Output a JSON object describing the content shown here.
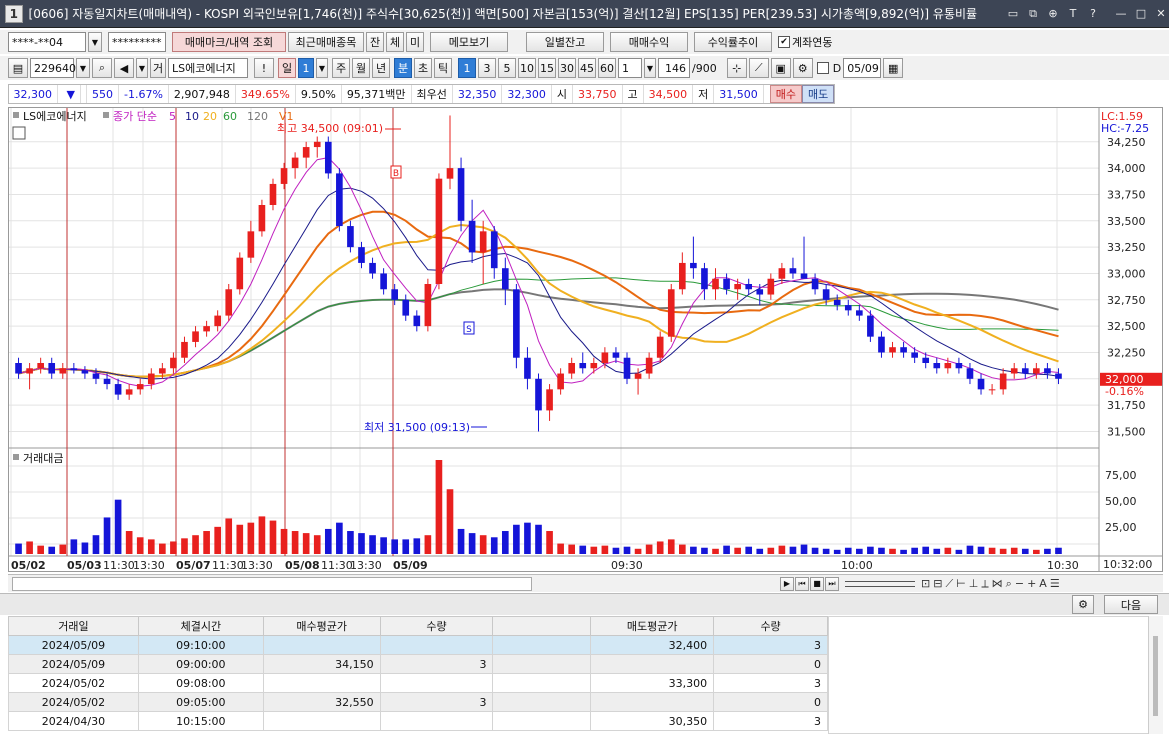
{
  "title": {
    "number": "1",
    "text": "[0606] 자동일지차트(매매내역) - KOSPI 외국인보유[1,746(천)] 주식수[30,625(천)] 액면[500] 자본금[153(억)] 결산[12월] EPS[135] PER[239.53] 시가총액[9,892(억)] 유통비률"
  },
  "toolbar1": {
    "account": "****-**04",
    "password": "*********",
    "mark_button": "매매마크/내역 조회",
    "recent_button": "최근매매종목",
    "b_jan": "잔",
    "b_che": "체",
    "b_mi": "미",
    "memo_button": "메모보기",
    "daily_balance": "일별잔고",
    "trade_profit": "매매수익",
    "return_trend": "수익률추이",
    "link_label": "계좌연동"
  },
  "toolbar2": {
    "code": "229640",
    "geo": "거",
    "name": "LS에코에너지",
    "excl": "!",
    "period_il": "일",
    "period_value": "1",
    "ju": "주",
    "wol": "월",
    "nyeon": "년",
    "bun": "분",
    "cho": "초",
    "tik": "틱",
    "intervals": [
      "1",
      "3",
      "5",
      "10",
      "15",
      "30",
      "45",
      "60"
    ],
    "count": "1",
    "bars": "146",
    "bars_total": "/900",
    "d_label": "D",
    "date": "05/09"
  },
  "quote": {
    "price": "32,300",
    "arrow": "▼",
    "change": "550",
    "change_pct": "-1.67%",
    "volume": "2,907,948",
    "vol_ratio": "349.65%",
    "turnover": "9.50%",
    "amount": "95,371백만",
    "priority_label": "최우선",
    "ask": "32,350",
    "bid": "32,300",
    "open_label": "시",
    "open": "33,750",
    "high_label": "고",
    "high": "34,500",
    "low_label": "저",
    "low": "31,500",
    "buy": "매수",
    "sell": "매도"
  },
  "chart": {
    "legend_name": "LS에코에너지",
    "legend_ma_label": "종가 단순",
    "ma_periods": [
      "5",
      "10",
      "20",
      "60",
      "120"
    ],
    "legend_v": "V1",
    "lc": "LC:1.59",
    "hc": "HC:-7.25",
    "high_note": "최고 34,500 (09:01)",
    "low_note": "최저 31,500 (09:13)",
    "b_marker": "B",
    "s_marker": "S",
    "y_ticks": [
      "34,250",
      "34,000",
      "33,750",
      "33,500",
      "33,250",
      "33,000",
      "32,750",
      "32,500",
      "32,250",
      "32,000",
      "31,750",
      "31,500"
    ],
    "current_price": "32,000",
    "current_pct": "-0.16%",
    "vol_label": "거래대금",
    "vol_ticks": [
      "75,00",
      "50,00",
      "25,00"
    ],
    "x_labels": [
      "05/02",
      "05/03",
      "11:30",
      "13:30",
      "05/07",
      "11:30",
      "13:30",
      "05/08",
      "11:30",
      "13:30",
      "05/09",
      "09:30",
      "10:00",
      "10:30"
    ],
    "time_right": "10:32:00",
    "colors": {
      "up": "#e8201e",
      "down": "#1515d8",
      "ma5": "#c020c0",
      "ma10": "#1a1a8a",
      "ma20": "#f0b020",
      "ma60": "#2a9a3a",
      "ma120": "#777777",
      "orange": "#e86a10"
    }
  },
  "chart_data": {
    "type": "candlestick",
    "ylim": [
      31400,
      34400
    ],
    "candles": [
      [
        32150,
        32200,
        32000,
        32050
      ],
      [
        32050,
        32150,
        31900,
        32100
      ],
      [
        32100,
        32200,
        32050,
        32150
      ],
      [
        32150,
        32200,
        32000,
        32050
      ],
      [
        32050,
        32150,
        32000,
        32100
      ],
      [
        32100,
        32150,
        32050,
        32080
      ],
      [
        32080,
        32120,
        32000,
        32050
      ],
      [
        32050,
        32100,
        31950,
        32000
      ],
      [
        32000,
        32050,
        31900,
        31950
      ],
      [
        31950,
        32000,
        31800,
        31850
      ],
      [
        31850,
        31950,
        31800,
        31900
      ],
      [
        31900,
        32000,
        31850,
        31950
      ],
      [
        31950,
        32100,
        31900,
        32050
      ],
      [
        32050,
        32150,
        32000,
        32100
      ],
      [
        32100,
        32250,
        32050,
        32200
      ],
      [
        32200,
        32400,
        32150,
        32350
      ],
      [
        32350,
        32500,
        32300,
        32450
      ],
      [
        32450,
        32550,
        32400,
        32500
      ],
      [
        32500,
        32650,
        32450,
        32600
      ],
      [
        32600,
        32900,
        32550,
        32850
      ],
      [
        32850,
        33200,
        32800,
        33150
      ],
      [
        33150,
        33500,
        33100,
        33400
      ],
      [
        33400,
        33700,
        33350,
        33650
      ],
      [
        33650,
        33900,
        33600,
        33850
      ],
      [
        33850,
        34050,
        33800,
        34000
      ],
      [
        34000,
        34150,
        33900,
        34100
      ],
      [
        34100,
        34250,
        34000,
        34200
      ],
      [
        34200,
        34300,
        34100,
        34250
      ],
      [
        34250,
        34300,
        33900,
        33950
      ],
      [
        33950,
        34000,
        33400,
        33450
      ],
      [
        33450,
        33500,
        33200,
        33250
      ],
      [
        33250,
        33300,
        33050,
        33100
      ],
      [
        33100,
        33150,
        32950,
        33000
      ],
      [
        33000,
        33050,
        32800,
        32850
      ],
      [
        32850,
        32900,
        32700,
        32750
      ],
      [
        32750,
        32800,
        32550,
        32600
      ],
      [
        32600,
        32650,
        32450,
        32500
      ],
      [
        32500,
        32950,
        32450,
        32900
      ],
      [
        32900,
        33950,
        32850,
        33900
      ],
      [
        33900,
        34500,
        33800,
        34000
      ],
      [
        34000,
        34100,
        33400,
        33500
      ],
      [
        33500,
        33700,
        33100,
        33200
      ],
      [
        33200,
        33500,
        32900,
        33400
      ],
      [
        33400,
        33450,
        32950,
        33050
      ],
      [
        33050,
        33150,
        32700,
        32850
      ],
      [
        32850,
        32900,
        32100,
        32200
      ],
      [
        32200,
        32300,
        31900,
        32000
      ],
      [
        32000,
        32050,
        31500,
        31700
      ],
      [
        31700,
        31950,
        31600,
        31900
      ],
      [
        31900,
        32100,
        31850,
        32050
      ],
      [
        32050,
        32200,
        32000,
        32150
      ],
      [
        32150,
        32250,
        32050,
        32100
      ],
      [
        32100,
        32200,
        32050,
        32150
      ],
      [
        32150,
        32300,
        32100,
        32250
      ],
      [
        32250,
        32300,
        32150,
        32200
      ],
      [
        32200,
        32250,
        31950,
        32000
      ],
      [
        32000,
        32100,
        31850,
        32050
      ],
      [
        32050,
        32250,
        32000,
        32200
      ],
      [
        32200,
        32450,
        32150,
        32400
      ],
      [
        32400,
        32900,
        32350,
        32850
      ],
      [
        32850,
        33200,
        32800,
        33100
      ],
      [
        33100,
        33350,
        32950,
        33050
      ],
      [
        33050,
        33100,
        32750,
        32850
      ],
      [
        32850,
        33050,
        32750,
        32950
      ],
      [
        32950,
        33000,
        32800,
        32850
      ],
      [
        32850,
        32950,
        32750,
        32900
      ],
      [
        32900,
        32950,
        32800,
        32850
      ],
      [
        32850,
        32900,
        32700,
        32800
      ],
      [
        32800,
        33000,
        32750,
        32950
      ],
      [
        32950,
        33100,
        32900,
        33050
      ],
      [
        33050,
        33150,
        32950,
        33000
      ],
      [
        33000,
        33350,
        32950,
        32950
      ],
      [
        32950,
        33000,
        32800,
        32850
      ],
      [
        32850,
        32900,
        32700,
        32750
      ],
      [
        32750,
        32800,
        32650,
        32700
      ],
      [
        32700,
        32750,
        32600,
        32650
      ],
      [
        32650,
        32700,
        32550,
        32600
      ],
      [
        32600,
        32650,
        32350,
        32400
      ],
      [
        32400,
        32450,
        32200,
        32250
      ],
      [
        32250,
        32350,
        32200,
        32300
      ],
      [
        32300,
        32350,
        32200,
        32250
      ],
      [
        32250,
        32300,
        32150,
        32200
      ],
      [
        32200,
        32250,
        32100,
        32150
      ],
      [
        32150,
        32200,
        32050,
        32100
      ],
      [
        32100,
        32200,
        32050,
        32150
      ],
      [
        32150,
        32200,
        32050,
        32100
      ],
      [
        32100,
        32150,
        31950,
        32000
      ],
      [
        32000,
        32050,
        31850,
        31900
      ],
      [
        31900,
        31950,
        31850,
        31900
      ],
      [
        31900,
        32100,
        31850,
        32050
      ],
      [
        32050,
        32150,
        32000,
        32100
      ],
      [
        32100,
        32150,
        32000,
        32050
      ],
      [
        32050,
        32150,
        32000,
        32100
      ],
      [
        32100,
        32150,
        32000,
        32050
      ],
      [
        32050,
        32100,
        31950,
        32000
      ]
    ],
    "volume": [
      10,
      12,
      8,
      7,
      9,
      14,
      11,
      18,
      35,
      52,
      22,
      16,
      14,
      10,
      12,
      15,
      18,
      22,
      26,
      34,
      28,
      30,
      36,
      32,
      24,
      22,
      20,
      18,
      24,
      30,
      22,
      20,
      18,
      16,
      14,
      14,
      15,
      18,
      90,
      62,
      24,
      20,
      18,
      16,
      22,
      28,
      30,
      28,
      22,
      10,
      9,
      8,
      7,
      8,
      6,
      7,
      5,
      9,
      12,
      14,
      9,
      7,
      6,
      5,
      8,
      6,
      7,
      5,
      6,
      8,
      7,
      9,
      6,
      5,
      4,
      6,
      5,
      7,
      6,
      5,
      4,
      6,
      7,
      5,
      6,
      4,
      8,
      7,
      6,
      5,
      6,
      5,
      4,
      5,
      6
    ]
  },
  "scroll": {
    "icons": [
      "▶",
      "⏮",
      "■",
      "⏭"
    ]
  },
  "bottom": {
    "settings": "설정",
    "next": "다음"
  },
  "table": {
    "headers": [
      "거래일",
      "체결시간",
      "매수평균가",
      "수량",
      "",
      "매도평균가",
      "수량"
    ],
    "rows": [
      [
        "2024/05/09",
        "09:10:00",
        "",
        "",
        "",
        "32,400",
        "3"
      ],
      [
        "2024/05/09",
        "09:00:00",
        "34,150",
        "3",
        "",
        "",
        "0"
      ],
      [
        "2024/05/02",
        "09:08:00",
        "",
        "",
        "",
        "33,300",
        "3"
      ],
      [
        "2024/05/02",
        "09:05:00",
        "32,550",
        "3",
        "",
        "",
        "0"
      ],
      [
        "2024/04/30",
        "10:15:00",
        "",
        "",
        "",
        "30,350",
        "3"
      ]
    ]
  }
}
